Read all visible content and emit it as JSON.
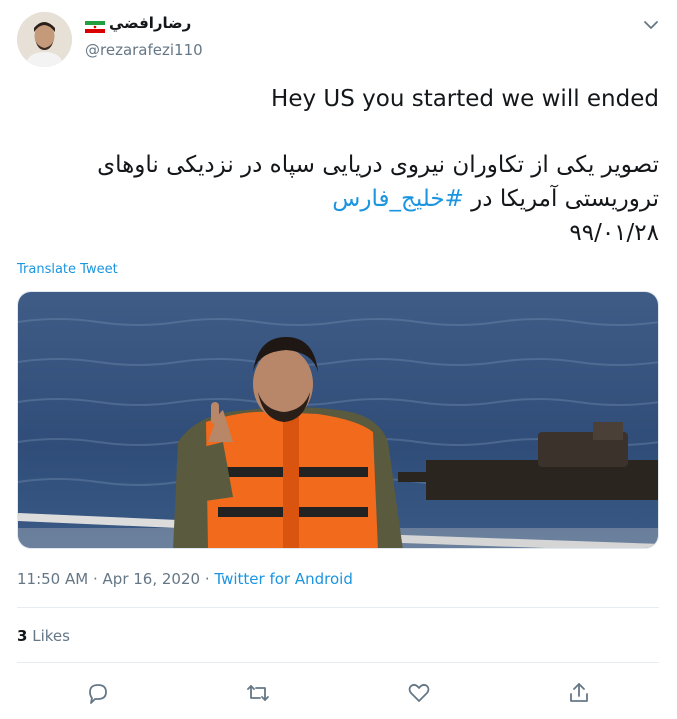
{
  "author": {
    "display_name": "رضارافضي",
    "handle": "@rezarafezi110",
    "flag": "iran-flag"
  },
  "tweet": {
    "text_en": "Hey US you started we will ended",
    "text_fa_line1": "تصویر یکی از تکاوران نیروی دریایی سپاه در نزدیکی ناوهای",
    "text_fa_line2_prefix": "تروریستی آمریکا در ",
    "hashtag": "#خلیج_فارس",
    "text_fa_line3": "۹۹/۰۱/۲۸",
    "translate_label": "Translate Tweet",
    "time": "11:50 AM",
    "date": "Apr 16, 2020",
    "separator": "·",
    "source": "Twitter for Android",
    "likes_count": "3",
    "likes_label": "Likes"
  },
  "actions": [
    "reply-icon",
    "retweet-icon",
    "like-icon",
    "share-icon"
  ],
  "colors": {
    "link": "#1b95e0",
    "secondary_text": "#657786",
    "primary_text": "#14171a",
    "divider": "#e6ecf0"
  }
}
